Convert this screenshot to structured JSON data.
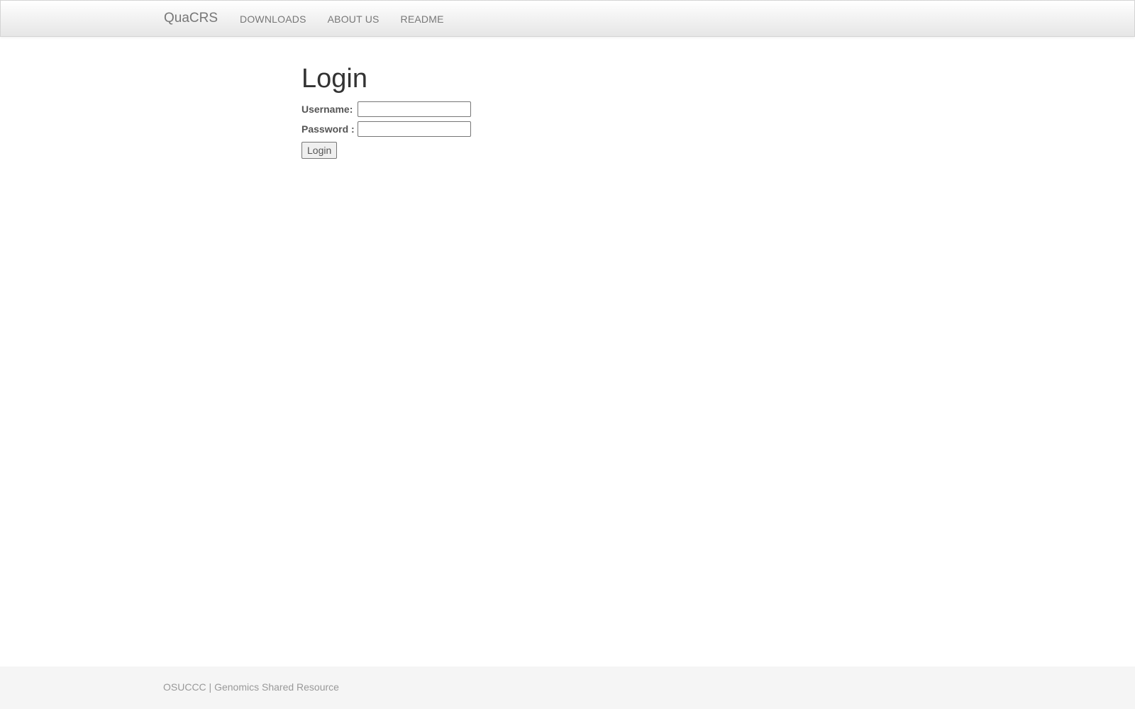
{
  "navbar": {
    "brand": "QuaCRS",
    "links": [
      {
        "label": "DOWNLOADS"
      },
      {
        "label": "ABOUT US"
      },
      {
        "label": "README"
      }
    ]
  },
  "login": {
    "title": "Login",
    "username_label": "Username:",
    "username_value": "",
    "password_label": "Password :",
    "password_value": "",
    "submit_label": "Login"
  },
  "footer": {
    "text": "OSUCCC | Genomics Shared Resource"
  }
}
